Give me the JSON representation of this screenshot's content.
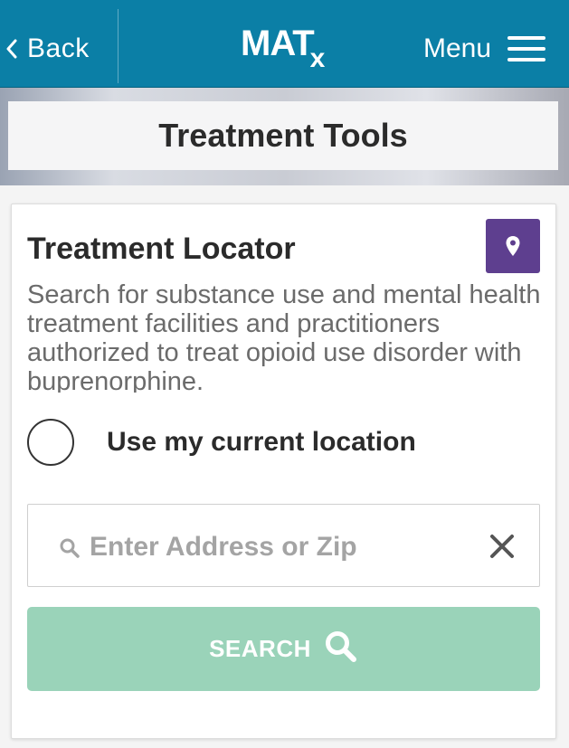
{
  "header": {
    "back_label": "Back",
    "logo_main": "MAT",
    "logo_sub": "x",
    "menu_label": "Menu",
    "bar_color": "#0b7fa6"
  },
  "banner": {
    "title": "Treatment Tools"
  },
  "locator": {
    "title": "Treatment Locator",
    "badge_icon": "location-pin-icon",
    "badge_color": "#5e3f8f",
    "description": "Search for substance use and mental health treatment facilities and practitioners authorized to treat opioid use disorder with buprenorphine.",
    "use_location_label": "Use my current location",
    "search_placeholder": "Enter Address or Zip",
    "search_value": "",
    "search_button_label": "SEARCH",
    "search_button_color": "#9ad3b9"
  }
}
